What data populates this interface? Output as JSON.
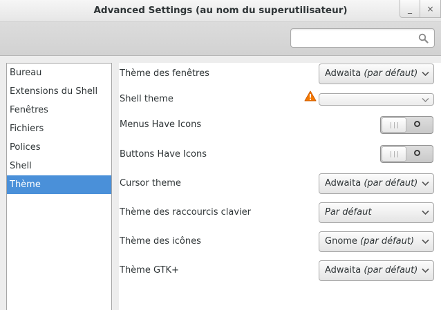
{
  "window": {
    "title": "Advanced Settings (au nom du superutilisateur)",
    "minimize_glyph": "_",
    "close_glyph": "×"
  },
  "search": {
    "value": "",
    "placeholder": "",
    "icon": "search-icon"
  },
  "sidebar": {
    "items": [
      {
        "label": "Bureau"
      },
      {
        "label": "Extensions du Shell"
      },
      {
        "label": "Fenêtres"
      },
      {
        "label": "Fichiers"
      },
      {
        "label": "Polices"
      },
      {
        "label": "Shell"
      },
      {
        "label": "Thème",
        "selected": true
      }
    ]
  },
  "settings": {
    "window_theme": {
      "label": "Thème des fenêtres",
      "value": "Adwaita",
      "suffix": "(par défaut)"
    },
    "shell_theme": {
      "label": "Shell theme",
      "value": "",
      "warning": true,
      "warning_color": "#f57900"
    },
    "menus_have_icons": {
      "label": "Menus Have Icons",
      "state": "off"
    },
    "buttons_have_icons": {
      "label": "Buttons Have Icons",
      "state": "off"
    },
    "cursor_theme": {
      "label": "Cursor theme",
      "value": "Adwaita",
      "suffix": "(par défaut)"
    },
    "keybinding_theme": {
      "label": "Thème des raccourcis clavier",
      "value": "Par défaut"
    },
    "icon_theme": {
      "label": "Thème des icônes",
      "value": "Gnome",
      "suffix": "(par défaut)"
    },
    "gtk_theme": {
      "label": "Thème GTK+",
      "value": "Adwaita",
      "suffix": "(par défaut)"
    }
  },
  "colors": {
    "selection": "#4a90d9",
    "text": "#2e3436"
  }
}
